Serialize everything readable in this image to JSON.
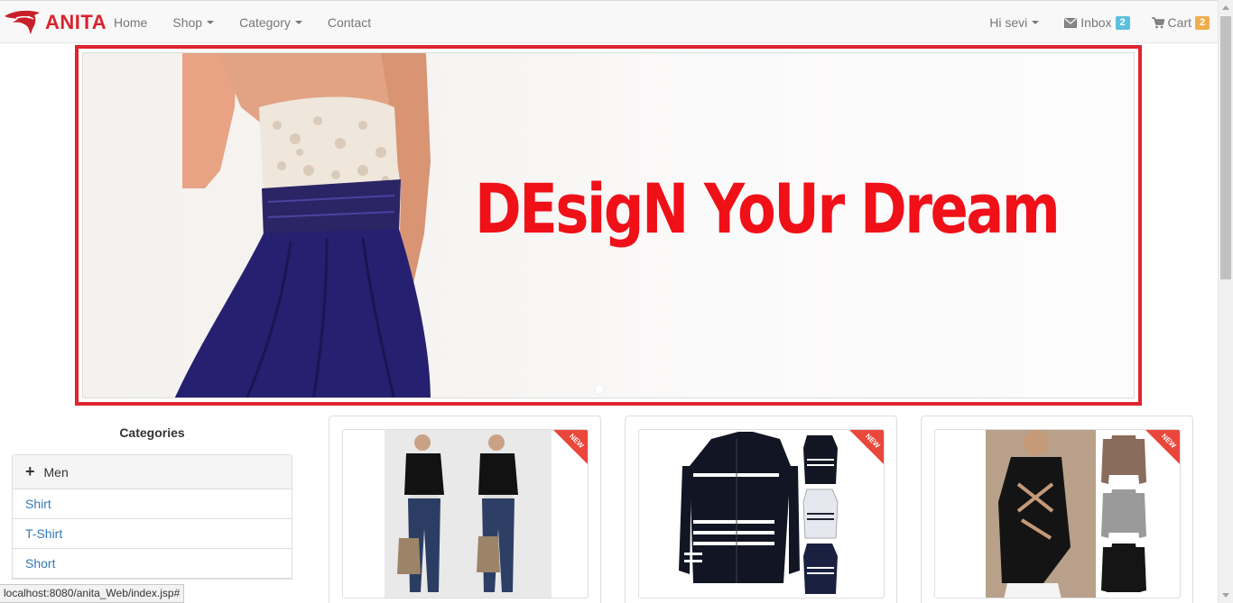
{
  "navbar": {
    "brand": "ANITA",
    "menu": [
      {
        "label": "Home",
        "dropdown": false
      },
      {
        "label": "Shop",
        "dropdown": true
      },
      {
        "label": "Category",
        "dropdown": true
      },
      {
        "label": "Contact",
        "dropdown": false
      }
    ],
    "user_label": "Hi sevi",
    "inbox_label": "Inbox",
    "inbox_count": "2",
    "cart_label": "Cart",
    "cart_count": "2"
  },
  "carousel": {
    "headline": "DEsigN YoUr Dream"
  },
  "sidebar": {
    "title": "Categories",
    "group_label": "Men",
    "items": [
      {
        "label": "Shirt"
      },
      {
        "label": "T-Shirt"
      },
      {
        "label": "Short"
      }
    ]
  },
  "products": [
    {
      "badge": "NEW"
    },
    {
      "badge": "NEW"
    },
    {
      "badge": "NEW"
    }
  ],
  "status_bar": {
    "url": "localhost:8080/anita_Web/index.jsp#"
  },
  "colors": {
    "brand": "#d9232d",
    "carousel_border": "#e0242f",
    "headline": "#f01018",
    "link": "#337ab7",
    "badge_info": "#5bc0de",
    "badge_warning": "#f0ad4e"
  }
}
